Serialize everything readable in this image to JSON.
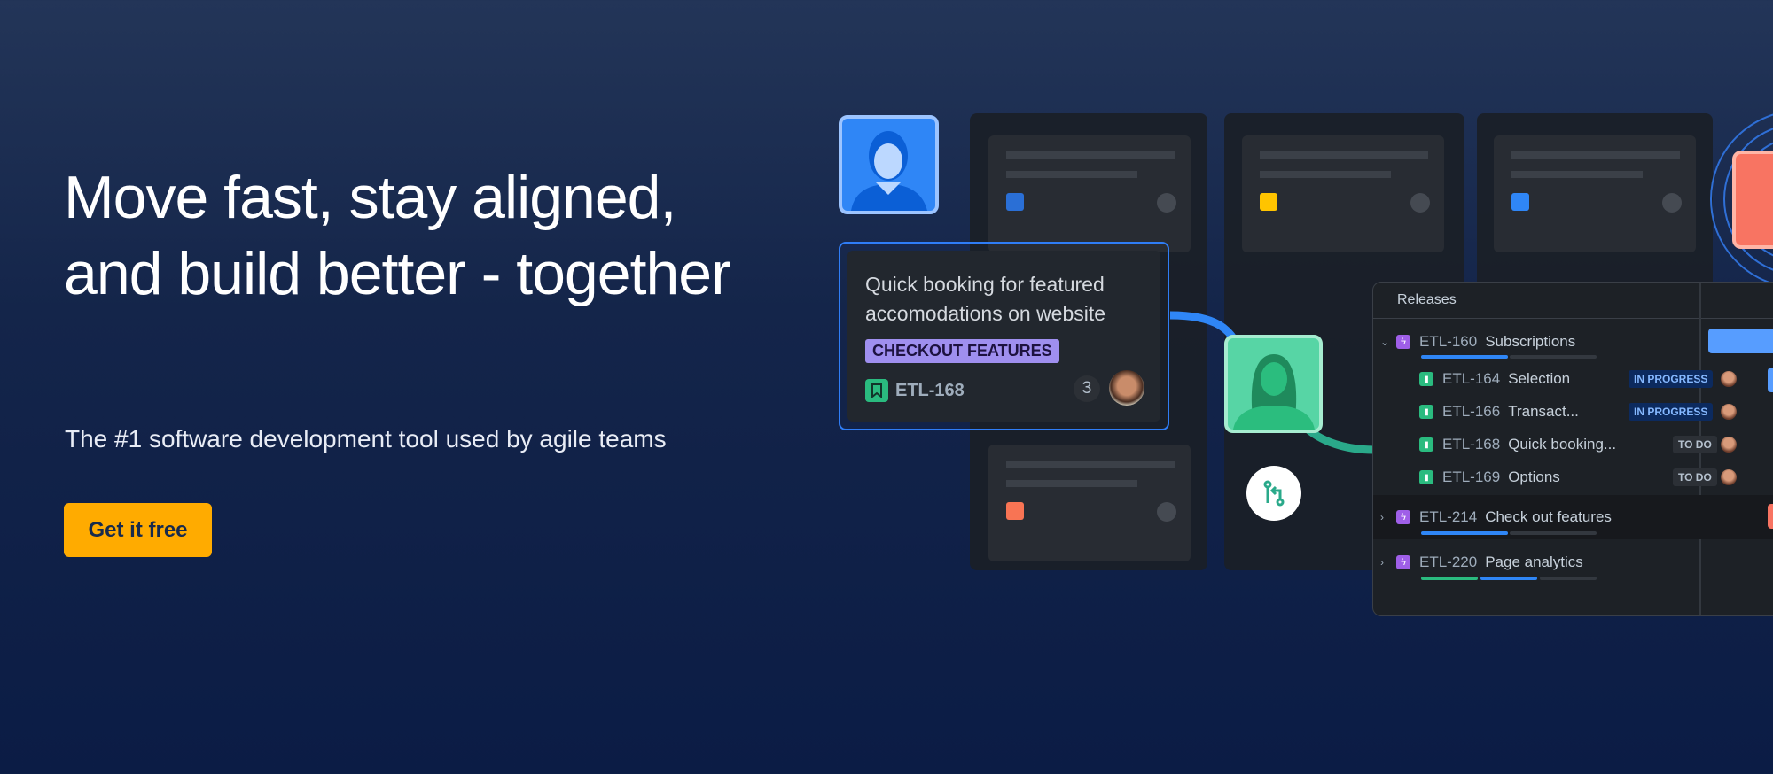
{
  "hero": {
    "headline": "Move fast, stay aligned, and build better - together",
    "subtitle": "The #1 software development tool used by agile teams",
    "cta_label": "Get it free"
  },
  "colors": {
    "cta": "#ffab00",
    "background": "#0b1c45",
    "accent_blue": "#2f7df6",
    "epic": "#9f5fe8",
    "story": "#2abb7f"
  },
  "card": {
    "title": "Quick booking for featured accomodations on website",
    "label": "CHECKOUT FEATURES",
    "issue_key": "ETL-168",
    "count": "3"
  },
  "releases": {
    "title": "Releases",
    "epics": [
      {
        "key": "ETL-160",
        "name": "Subscriptions",
        "expanded": true,
        "progress_done": 0,
        "progress_in_progress": 0.5
      },
      {
        "key": "ETL-214",
        "name": "Check out features",
        "expanded": false,
        "progress_done": 0,
        "progress_in_progress": 0.5
      },
      {
        "key": "ETL-220",
        "name": "Page analytics",
        "expanded": false,
        "progress_done": 0.33,
        "progress_in_progress": 0.33
      }
    ],
    "stories": [
      {
        "key": "ETL-164",
        "name": "Selection",
        "status": "IN PROGRESS"
      },
      {
        "key": "ETL-166",
        "name": "Transact...",
        "status": "IN PROGRESS"
      },
      {
        "key": "ETL-168",
        "name": "Quick booking...",
        "status": "TO DO"
      },
      {
        "key": "ETL-169",
        "name": "Options",
        "status": "TO DO"
      }
    ]
  }
}
